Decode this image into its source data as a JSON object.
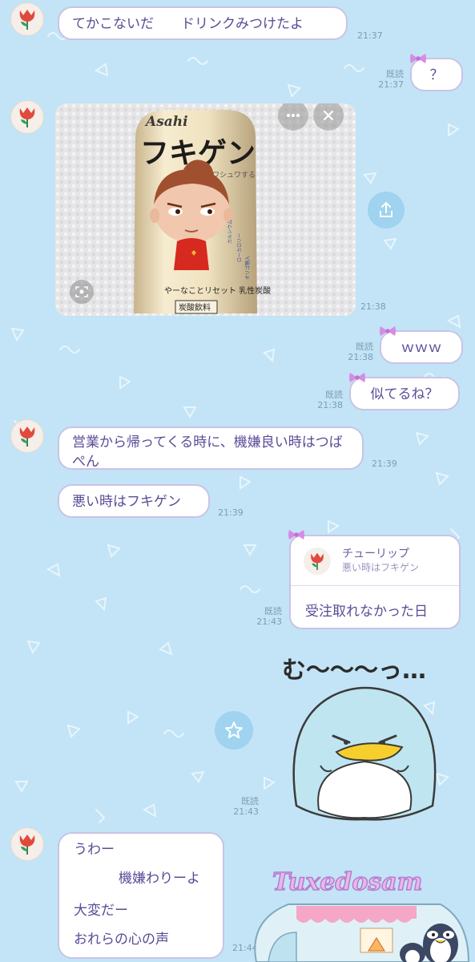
{
  "messages": {
    "m1": {
      "text": "てかこないだ　　ドリンクみつけたよ",
      "time": "21:37"
    },
    "m2": {
      "text": "？",
      "read": "既読",
      "time": "21:37"
    },
    "m3": {
      "time": "21:38"
    },
    "m4": {
      "text": "ｗｗｗ",
      "read": "既読",
      "time": "21:38"
    },
    "m5": {
      "text": "似てるね？",
      "read": "既読",
      "time": "21:38"
    },
    "m6": {
      "text": "営業から帰ってくる時に、機嫌良い時はつばぺん",
      "time": "21:39"
    },
    "m7": {
      "text": "悪い時はフキゲン",
      "time": "21:39"
    },
    "m8": {
      "reply_name": "チューリップ",
      "reply_quote": "悪い時はフキゲン",
      "text": "受注取れなかった日",
      "read": "既読",
      "time": "21:43"
    },
    "m9": {
      "sticker_text": "む〜〜〜っ…",
      "read": "既読",
      "time": "21:43"
    },
    "m10": {
      "line1": "うわー",
      "line2": "機嫌わりーよ",
      "line3": "大変だー",
      "line4": "おれらの心の声",
      "time": "21:44"
    }
  },
  "photo": {
    "brand": "Asahi",
    "product": "フキゲン",
    "subtitle": "シュワシュワする",
    "tagline": "やーなことリセット 乳性炭酸",
    "label": "炭酸飲料",
    "side1": "カルシウム",
    "side2": "ローカロリー",
    "side3": "オリゴ糖入"
  },
  "sticker2": {
    "title": "Tuxedosam"
  },
  "icons": {
    "more": "more-icon",
    "close": "close-icon",
    "share": "share-icon",
    "lens": "lens-icon",
    "star": "star-icon"
  },
  "colors": {
    "background": "#c2e4f6",
    "bubble_border": "#c9c3e6",
    "text": "#5b4b96",
    "bow": "#d68be4",
    "avatar_flower": "#e04a3c"
  }
}
